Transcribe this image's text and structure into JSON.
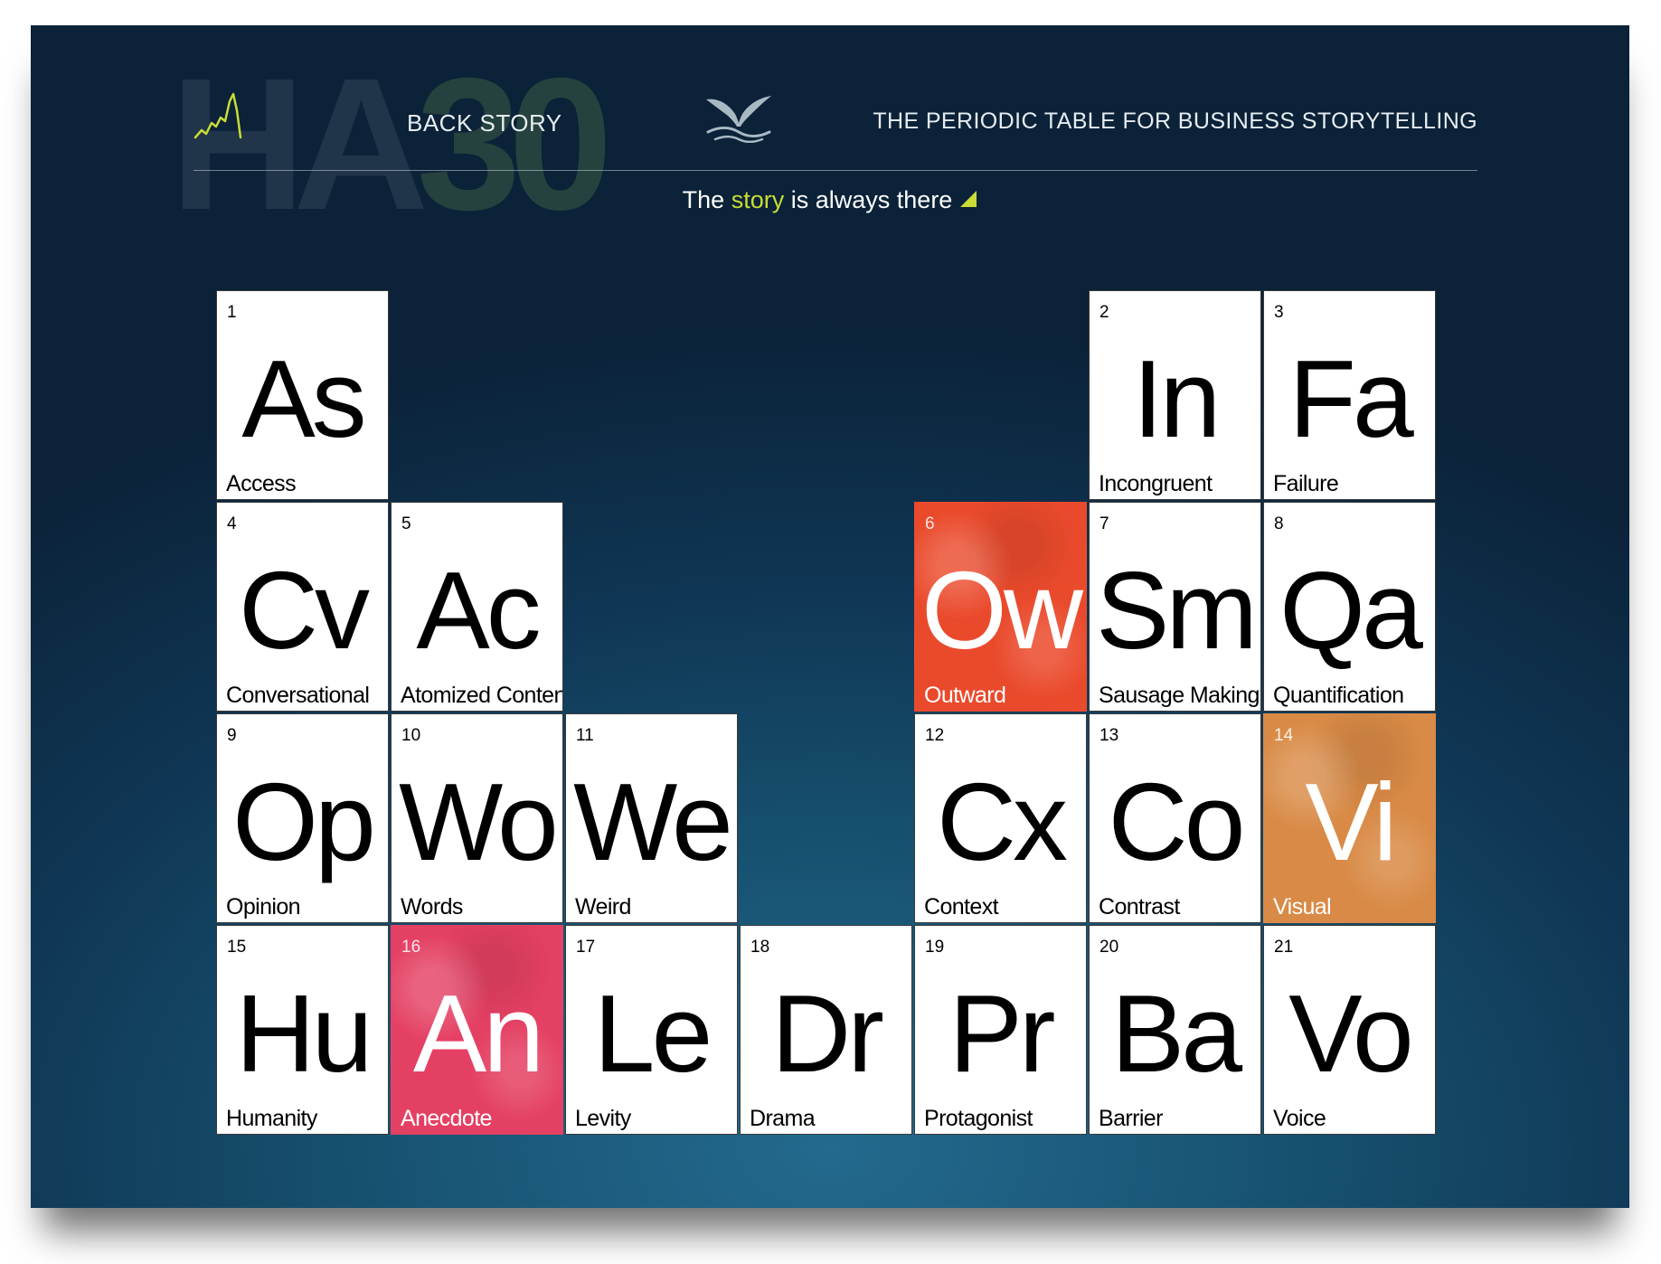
{
  "header": {
    "logo_letters": "HA",
    "logo_number": "30",
    "back_story_label": "BACK STORY",
    "title": "THE PERIODIC TABLE FOR BUSINESS STORYTELLING",
    "icons": [
      "chart-sparkline-icon",
      "whale-tail-icon"
    ]
  },
  "tagline": {
    "before": "The",
    "highlight": "story",
    "after": "is always there",
    "icon": "triangle-icon"
  },
  "colors": {
    "accent_green": "#c9dc37",
    "outward": "#ea4a2c",
    "visual": "#d98a46",
    "anecdote": "#e44063",
    "cell_background": "#ffffff"
  },
  "elements": [
    {
      "number": "1",
      "symbol": "As",
      "name": "Access"
    },
    {
      "number": "2",
      "symbol": "In",
      "name": "Incongruent"
    },
    {
      "number": "3",
      "symbol": "Fa",
      "name": "Failure"
    },
    {
      "number": "4",
      "symbol": "Cv",
      "name": "Conversational"
    },
    {
      "number": "5",
      "symbol": "Ac",
      "name": "Atomized Content"
    },
    {
      "number": "6",
      "symbol": "Ow",
      "name": "Outward",
      "highlight": "outward"
    },
    {
      "number": "7",
      "symbol": "Sm",
      "name": "Sausage Making"
    },
    {
      "number": "8",
      "symbol": "Qa",
      "name": "Quantification"
    },
    {
      "number": "9",
      "symbol": "Op",
      "name": "Opinion"
    },
    {
      "number": "10",
      "symbol": "Wo",
      "name": "Words"
    },
    {
      "number": "11",
      "symbol": "We",
      "name": "Weird"
    },
    {
      "number": "12",
      "symbol": "Cx",
      "name": "Context"
    },
    {
      "number": "13",
      "symbol": "Co",
      "name": "Contrast"
    },
    {
      "number": "14",
      "symbol": "Vi",
      "name": "Visual",
      "highlight": "visual"
    },
    {
      "number": "15",
      "symbol": "Hu",
      "name": "Humanity"
    },
    {
      "number": "16",
      "symbol": "An",
      "name": "Anecdote",
      "highlight": "anecdote"
    },
    {
      "number": "17",
      "symbol": "Le",
      "name": "Levity"
    },
    {
      "number": "18",
      "symbol": "Dr",
      "name": "Drama"
    },
    {
      "number": "19",
      "symbol": "Pr",
      "name": "Protagonist"
    },
    {
      "number": "20",
      "symbol": "Ba",
      "name": "Barrier"
    },
    {
      "number": "21",
      "symbol": "Vo",
      "name": "Voice"
    }
  ]
}
